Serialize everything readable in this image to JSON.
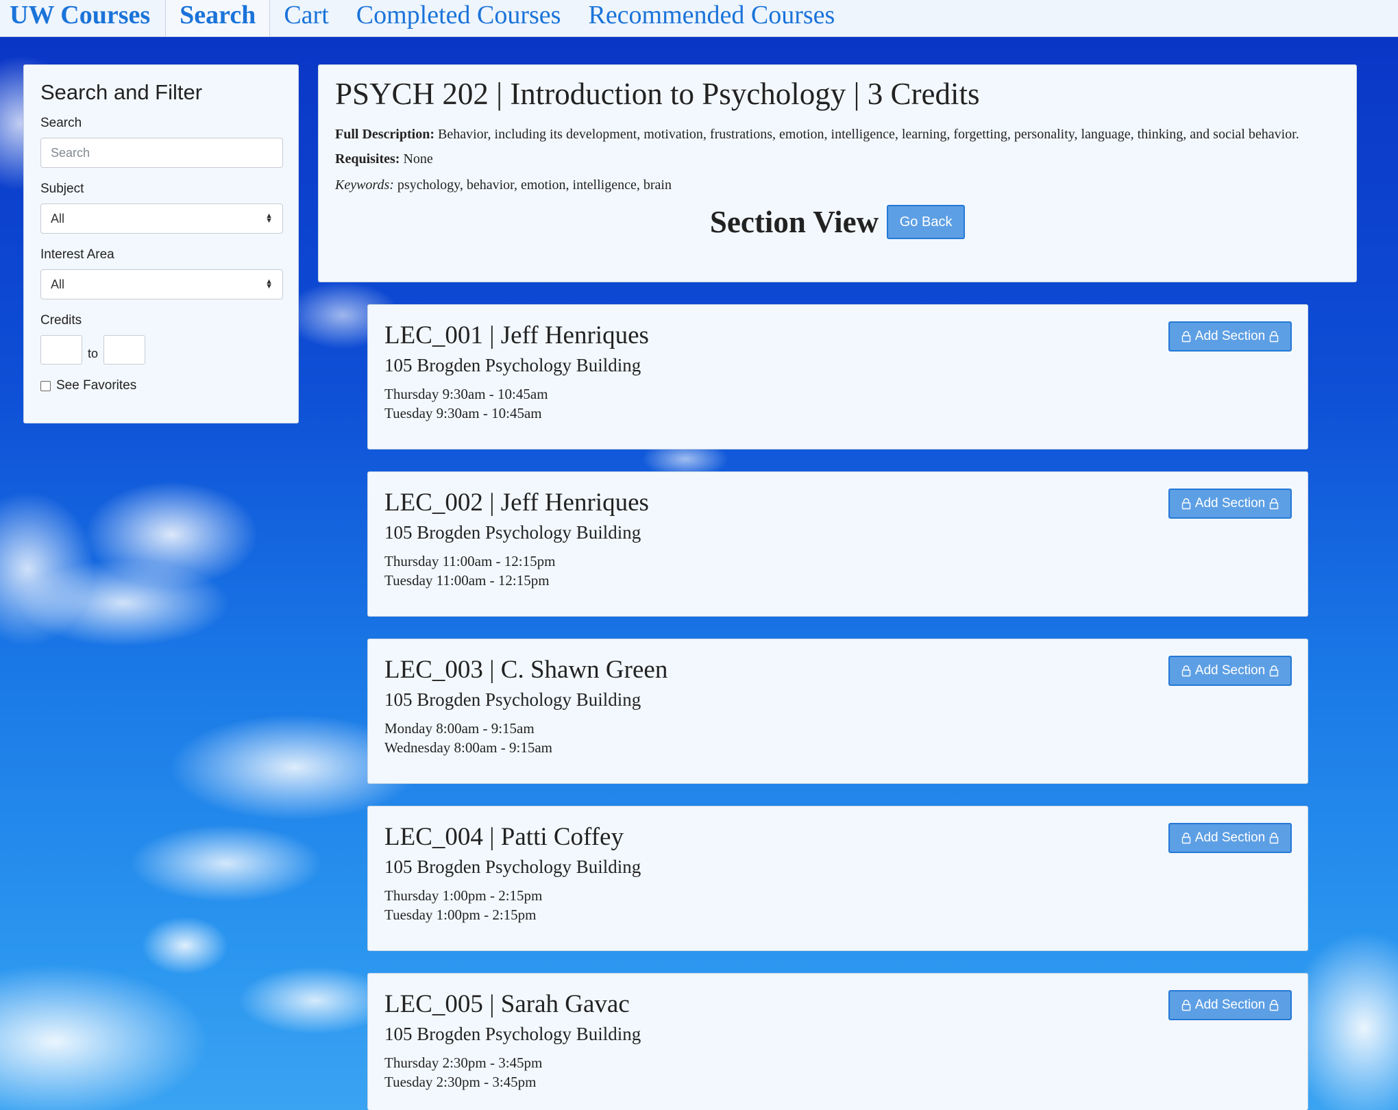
{
  "nav": {
    "brand": "UW Courses",
    "items": [
      {
        "label": "Search"
      },
      {
        "label": "Cart"
      },
      {
        "label": "Completed Courses"
      },
      {
        "label": "Recommended Courses"
      }
    ]
  },
  "sidebar": {
    "title": "Search and Filter",
    "search_label": "Search",
    "search_placeholder": "Search",
    "subject_label": "Subject",
    "subject_value": "All",
    "interest_label": "Interest Area",
    "interest_value": "All",
    "credits_label": "Credits",
    "credits_to": "to",
    "favorites_label": "See Favorites"
  },
  "course": {
    "title": "PSYCH 202 | Introduction to Psychology | 3 Credits",
    "desc_label": "Full Description:",
    "desc": "Behavior, including its development, motivation, frustrations, emotion, intelligence, learning, forgetting, personality, language, thinking, and social behavior.",
    "req_label": "Requisites:",
    "req": "None",
    "kw_label": "Keywords:",
    "kw": "psychology, behavior, emotion, intelligence, brain",
    "section_view": "Section View",
    "go_back": "Go Back"
  },
  "sections": [
    {
      "title": "LEC_001 | Jeff Henriques",
      "location": "105 Brogden Psychology Building",
      "times": [
        "Thursday 9:30am - 10:45am",
        "Tuesday 9:30am - 10:45am"
      ],
      "button": "Add Section"
    },
    {
      "title": "LEC_002 | Jeff Henriques",
      "location": "105 Brogden Psychology Building",
      "times": [
        "Thursday 11:00am - 12:15pm",
        "Tuesday 11:00am - 12:15pm"
      ],
      "button": "Add Section"
    },
    {
      "title": "LEC_003 | C. Shawn Green",
      "location": "105 Brogden Psychology Building",
      "times": [
        "Monday 8:00am - 9:15am",
        "Wednesday 8:00am - 9:15am"
      ],
      "button": "Add Section"
    },
    {
      "title": "LEC_004 | Patti Coffey",
      "location": "105 Brogden Psychology Building",
      "times": [
        "Thursday 1:00pm - 2:15pm",
        "Tuesday 1:00pm - 2:15pm"
      ],
      "button": "Add Section"
    },
    {
      "title": "LEC_005 | Sarah Gavac",
      "location": "105 Brogden Psychology Building",
      "times": [
        "Thursday 2:30pm - 3:45pm",
        "Tuesday 2:30pm - 3:45pm"
      ],
      "button": "Add Section"
    }
  ],
  "icons": {
    "add_section_icon": "lock-icon"
  },
  "colors": {
    "accent": "#1a73d9",
    "button": "#5d9fe4",
    "card": "#f3f8fe"
  }
}
